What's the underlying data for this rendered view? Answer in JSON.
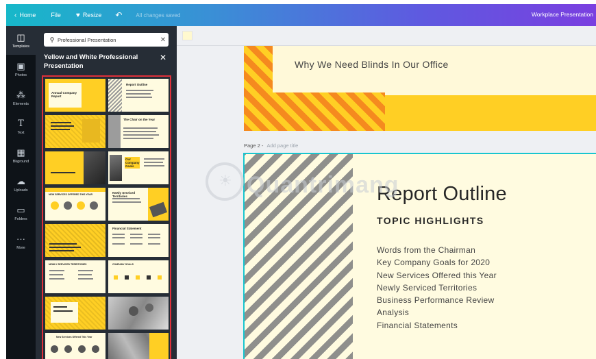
{
  "topbar": {
    "home_label": "Home",
    "file_label": "File",
    "resize_label": "Resize",
    "saved_status": "All changes saved",
    "doc_title": "Workplace Presentation"
  },
  "rail": {
    "items": [
      {
        "label": "Templates",
        "icon": "template-icon"
      },
      {
        "label": "Photos",
        "icon": "photo-icon"
      },
      {
        "label": "Elements",
        "icon": "elements-icon"
      },
      {
        "label": "Text",
        "icon": "text-icon"
      },
      {
        "label": "Bkground",
        "icon": "background-icon"
      },
      {
        "label": "Uploads",
        "icon": "upload-icon"
      },
      {
        "label": "Folders",
        "icon": "folder-icon"
      },
      {
        "label": "More",
        "icon": "more-icon"
      }
    ]
  },
  "panel": {
    "search_value": "Professional Presentation",
    "title": "Yellow and White Professional Presentation",
    "thumbs": [
      {
        "title": "Annual Company Report"
      },
      {
        "title": "Report Outline"
      },
      {
        "title": ""
      },
      {
        "title": "The Chair on the Year"
      },
      {
        "title": ""
      },
      {
        "title": "Our Company Goals"
      },
      {
        "title": "NEW SERVICES OFFERED THIS YEAR"
      },
      {
        "title": "Newly Serviced Territories"
      },
      {
        "title": ""
      },
      {
        "title": "Financial Statement"
      },
      {
        "title": "NEWLY SERVICED TERRITORIES"
      },
      {
        "title": "COMPANY GOALS"
      },
      {
        "title": ""
      },
      {
        "title": ""
      },
      {
        "title": "New Services Offered This Year"
      },
      {
        "title": ""
      }
    ]
  },
  "canvas": {
    "page1_title": "Why We Need Blinds In Our Office",
    "page2_label": "Page 2 -",
    "page2_add_title": "Add page title",
    "page2_title": "Report Outline",
    "page2_subtitle": "TOPIC HIGHLIGHTS",
    "page2_items": [
      "Words from the Chairman",
      "Key Company Goals for 2020",
      "New Services Offered this Year",
      "Newly Serviced Territories",
      "Business Performance Review",
      "Analysis",
      "Financial Statements"
    ]
  },
  "watermark": "Quantrimang",
  "colors": {
    "accent_teal": "#19c6cf",
    "highlight_red": "#e0303a",
    "panel_dark": "#262d36",
    "brand_yellow": "#ffcf24",
    "brand_orange": "#f58a1f"
  }
}
